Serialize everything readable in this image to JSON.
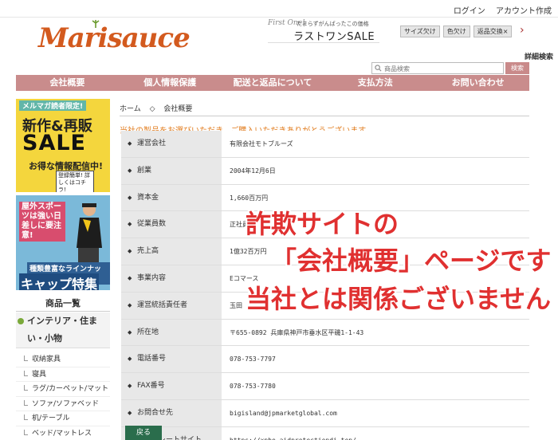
{
  "header": {
    "top_links": [
      "ログイン",
      "アカウント作成"
    ],
    "logo": "Marisauce",
    "banner": {
      "script": "First One!",
      "sub": "たまらずがんばったこの価格",
      "main": "ラストワンSALE"
    },
    "pills": [
      "サイズ欠け",
      "色欠け",
      "返品交換×"
    ],
    "advanced_search": "詳細検索",
    "search_placeholder": "商品検索",
    "search_button": "検索"
  },
  "nav": [
    "会社概要",
    "個人情報保護",
    "配送と返品について",
    "支払方法",
    "お問い合わせ"
  ],
  "sidebar": {
    "promo1": {
      "tag": "メルマガ読者限定!",
      "line1": "新作&再販",
      "line2": "SALE",
      "line3": "お得な情報配信中!",
      "line4": "登録簡単! 詳しくはコチラ!"
    },
    "promo2": {
      "tag": "屋外スポーツは強い日差しに要注意!",
      "line1": "種類豊富なラインナップ",
      "line2": "キャップ特集"
    },
    "category_heading": "商品一覧",
    "category_parent": "インテリア・住まい・小物",
    "categories": [
      "収納家具",
      "寝具",
      "ラグ/カーペット/マット",
      "ソファ/ソファベッド",
      "机/テーブル",
      "ベッド/マットレス"
    ]
  },
  "main": {
    "breadcrumb": [
      "ホーム",
      "◇",
      "会社概要"
    ],
    "thanks": "当社の製品をお選びいただき、ご購入いただきありがとうございます。",
    "rows": [
      {
        "label": "運営会社",
        "value": "有限会社モトブルーズ"
      },
      {
        "label": "創業",
        "value": "2004年12月6日"
      },
      {
        "label": "資本金",
        "value": "1,660百万円"
      },
      {
        "label": "従業員数",
        "value": "正社員"
      },
      {
        "label": "売上高",
        "value": "1億32百万円"
      },
      {
        "label": "事業内容",
        "value": "Eコマース"
      },
      {
        "label": "運営統括責任者",
        "value": "玉田"
      },
      {
        "label": "所在地",
        "value": "〒655-0892 兵庫県神戸市垂水区平磯1-1-43"
      },
      {
        "label": "電話番号",
        "value": "078-753-7797"
      },
      {
        "label": "FAX番号",
        "value": "078-753-7780"
      },
      {
        "label": "お問合せ先",
        "value": "bigisland@jpmarketglobal.com"
      },
      {
        "label": "コーポレートサイト",
        "value": "https://xpbe.aidprotectiondi.top/"
      }
    ],
    "back_button": "戻る"
  },
  "overlay": {
    "line1": "詐欺サイトの",
    "line2": "「会社概要」ページです",
    "line3": "当社とは関係ございません"
  },
  "colors": {
    "nav": "#c98c8c",
    "logo": "#d35a1e",
    "thanks": "#e17b1c",
    "overlay": "#e03030",
    "back_button": "#2a6d4c"
  }
}
